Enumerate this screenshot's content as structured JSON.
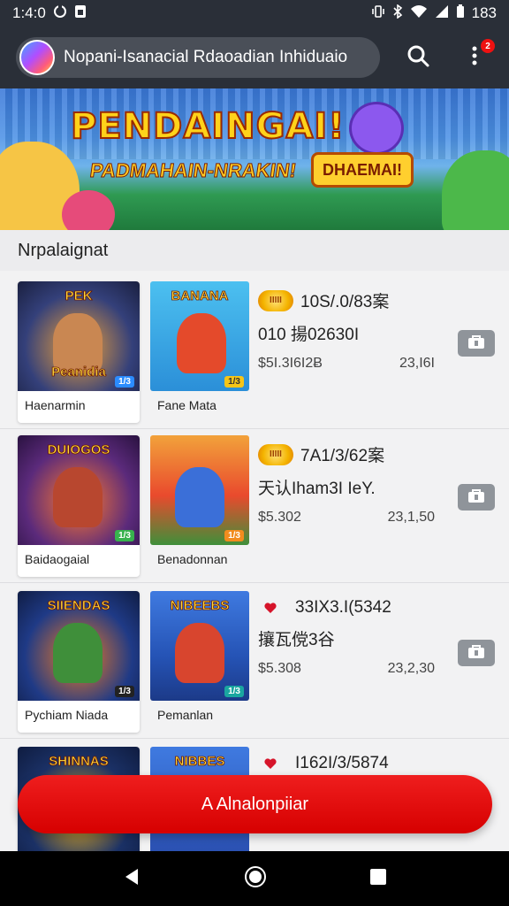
{
  "status_bar": {
    "time": "1:4:0",
    "battery": "183"
  },
  "app_bar": {
    "search_text": "Nopani-Isanacial Rdaoadian Inhiduaio",
    "notification_count": "2"
  },
  "hero": {
    "title": "PENDAINGAI!",
    "subtitle": "PADMAHAIN-NRAKIN!",
    "badge": "DHAEMAI!"
  },
  "section": {
    "title": "Nrpalaignat"
  },
  "rows": [
    {
      "card1": {
        "title": "Haenarmin",
        "thumb_label": "PEK",
        "thumb_sub": "Peanidia",
        "bg": "#2b3b64",
        "accent": "#f3a31f"
      },
      "card2": {
        "title": "Fane Mata",
        "thumb_label": "BANANA",
        "bg": "#37a6e8",
        "accent": "#e44a2b"
      },
      "info": {
        "coin": "IIIII",
        "line1": "10S/.0/83案",
        "line2": "010 揚02630I",
        "price": "$5I.3I6I2Ƀ",
        "rating": "23,I6I"
      }
    },
    {
      "card1": {
        "title": "Baidaogaial",
        "thumb_label": "DUIOGOS",
        "bg": "#5b2a7b",
        "accent": "#ff8b22"
      },
      "card2": {
        "title": "Benadonnan",
        "thumb_label": "",
        "bg": "#e94a2d",
        "accent": "#3b6fd8"
      },
      "info": {
        "coin": "IIIII",
        "line1": "7A1/3/62案",
        "line2": "天认Iham3I IeY.",
        "price": "$5.302",
        "rating": "23,1,50"
      }
    },
    {
      "card1": {
        "title": "Pychiam Niada",
        "thumb_label": "SIIENDAS",
        "bg": "#1f3a86",
        "accent": "#f47b22"
      },
      "card2": {
        "title": "Pemanlan",
        "thumb_label": "NIBEEBS",
        "bg": "#2553b5",
        "accent": "#f2c52e"
      },
      "info": {
        "coin": "",
        "line1": "33IX3.I(5342",
        "line2": "攘瓦傥3谷",
        "price": "$5.308",
        "rating": "23,2,30"
      }
    },
    {
      "card1": {
        "title": "",
        "thumb_label": "SHINNAS",
        "bg": "#1b3166",
        "accent": "#f6b81c"
      },
      "card2": {
        "title": "",
        "thumb_label": "NIBBES",
        "bg": "#2a4fb0",
        "accent": "#f4c22e"
      },
      "info": {
        "coin": "",
        "line1": "I162I/3/5874",
        "line2": "",
        "price": "",
        "rating": ""
      }
    }
  ],
  "cta": {
    "label": "A Alnalonpiiar"
  },
  "colors": {
    "bar": "#2a2f38",
    "cta": "#e01010",
    "accent_red": "#d6142a"
  }
}
